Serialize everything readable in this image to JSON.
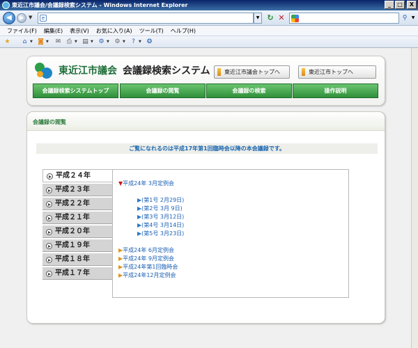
{
  "window": {
    "title": "東近江市議会/会議録検索システム - Windows Internet Explorer",
    "minimize": "_",
    "maximize": "□",
    "close": "X"
  },
  "address_bar": {
    "value": "",
    "placeholder": ""
  },
  "search_bar": {
    "value": "",
    "placeholder": ""
  },
  "menu": [
    "ファイル(F)",
    "編集(E)",
    "表示(V)",
    "お気に入り(A)",
    "ツール(T)",
    "ヘルプ(H)"
  ],
  "header": {
    "org_name": "東近江市議会",
    "system_name": "会議録検索システム",
    "link_council_top": "東近江市議会トップへ",
    "link_city_top": "東近江市トップへ"
  },
  "nav": [
    "会議録検索システムトップ",
    "会議録の閲覧",
    "会議録の検索",
    "操作説明"
  ],
  "panel": {
    "title": "会議録の閲覧",
    "notice": "ご覧になれるのは平成17年第1回臨時会以降の本会議録です。"
  },
  "years": [
    {
      "label": "平成２４年",
      "active": true
    },
    {
      "label": "平成２３年",
      "active": false
    },
    {
      "label": "平成２２年",
      "active": false
    },
    {
      "label": "平成２１年",
      "active": false
    },
    {
      "label": "平成２０年",
      "active": false
    },
    {
      "label": "平成１９年",
      "active": false
    },
    {
      "label": "平成１８年",
      "active": false
    },
    {
      "label": "平成１７年",
      "active": false
    }
  ],
  "sessions": {
    "active": "平成24年 3月定例会",
    "meetings": [
      "(第1号 2月29日)",
      "(第2号 3月 9日)",
      "(第3号 3月12日)",
      "(第4号 3月14日)",
      "(第5号 3月23日)"
    ],
    "others": [
      "平成24年 6月定例会",
      "平成24年 9月定例会",
      "平成24年第1回臨時会",
      "平成24年12月定例会"
    ]
  },
  "colors": {
    "brand_green": "#2f8f3a",
    "link_blue": "#1a5fb4",
    "marker_red": "#c81818",
    "marker_orange": "#e0951c"
  },
  "icons": {
    "back": "back-arrow-icon",
    "forward": "forward-arrow-icon",
    "refresh": "refresh-icon",
    "stop": "stop-icon",
    "search": "magnifier-icon"
  }
}
